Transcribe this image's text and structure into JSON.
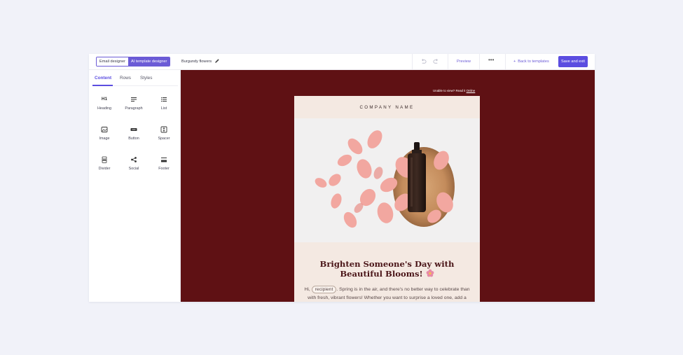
{
  "topbar": {
    "mode_email": "Email designer",
    "mode_ai": "AI template designer",
    "template_name": "Burgundy flowers",
    "preview": "Preview",
    "more": "•••",
    "back": "Back to templates",
    "back_prefix": "+",
    "save": "Save and exit"
  },
  "sidebar": {
    "tabs": [
      "Content",
      "Rows",
      "Styles"
    ],
    "blocks": {
      "heading": "Heading",
      "heading_glyph": "H1",
      "paragraph": "Paragraph",
      "list": "List",
      "image": "Image",
      "button": "Button",
      "spacer": "Spacer",
      "divider": "Divider",
      "social": "Social",
      "footer": "Footer"
    }
  },
  "canvas": {
    "unable_text": "Unable to view? Read it",
    "online": "Online",
    "company_name": "COMPANY NAME",
    "headline": "Brighten Someone's Day with Beautiful Blooms!",
    "body_greeting": "Hi,",
    "recipient_tag": "recipient",
    "body_text": ". Spring is in the air, and there's no better way to celebrate than with fresh, vibrant flowers! Whether you want to surprise a loved one, add a"
  },
  "colors": {
    "accent": "#5b4de0",
    "canvas_bg": "#5f1114",
    "email_bg": "#f4e9e2",
    "headline": "#4a1518"
  },
  "icons": [
    "pencil-icon",
    "undo-icon",
    "redo-icon",
    "more-icon",
    "heading-icon",
    "paragraph-icon",
    "list-icon",
    "image-icon",
    "button-icon",
    "spacer-icon",
    "divider-icon",
    "social-icon",
    "footer-icon",
    "flower-icon"
  ]
}
